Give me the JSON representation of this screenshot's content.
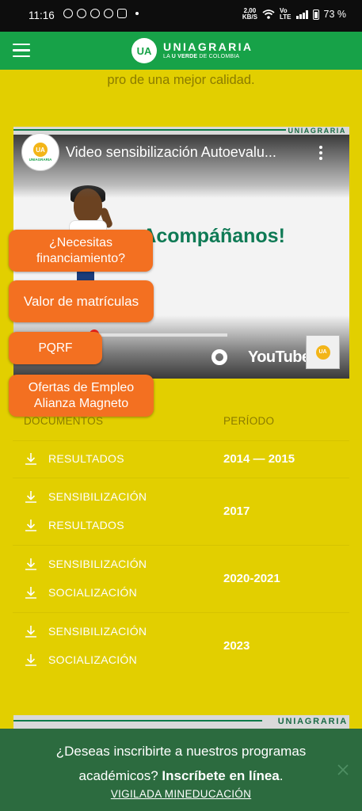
{
  "status_bar": {
    "time": "11:16",
    "speed_value": "2,00",
    "speed_unit": "KB/S",
    "network_label_1": "Vo",
    "network_label_2": "LTE",
    "battery": "73 %"
  },
  "header": {
    "logo_mark": "UA",
    "logo_name": "UNIAGRARIA",
    "logo_tagline_prefix": "LA ",
    "logo_tagline_bold": "U VERDE",
    "logo_tagline_suffix": " DE COLOMBIA",
    "menu_icon": "hamburger-icon"
  },
  "intro_text": "pro de una mejor calidad.",
  "video": {
    "brand_strip": "UNIAGRARIA",
    "channel_mark": "UA",
    "channel_name": "UNIAGRARIA",
    "title": "Video sensibilización Autoevalu...",
    "headline": "¡Acompáñanos!",
    "youtube_label": "YouTube",
    "progress_percent": 2,
    "thumb_mark": "UA"
  },
  "floating_buttons": [
    {
      "label": "¿Necesitas financiamiento?"
    },
    {
      "label": "Valor de matrículas"
    },
    {
      "label": "PQRF"
    },
    {
      "label": "Ofertas de Empleo Alianza Magneto"
    }
  ],
  "documents": {
    "col_documents": "DOCUMENTOS",
    "col_period": "PERÍODO",
    "rows": [
      {
        "links": [
          "RESULTADOS"
        ],
        "period": "2014 — 2015"
      },
      {
        "links": [
          "SENSIBILIZACIÓN",
          "RESULTADOS"
        ],
        "period": "2017"
      },
      {
        "links": [
          "SENSIBILIZACIÓN",
          "SOCIALIZACIÓN"
        ],
        "period": "2020-2021"
      },
      {
        "links": [
          "SENSIBILIZACIÓN",
          "SOCIALIZACIÓN"
        ],
        "period": "2023"
      }
    ]
  },
  "next_video_brand": "UNIAGRARIA",
  "banner": {
    "line1": "¿Deseas inscribirte a nuestros programas",
    "line2_prefix": "académicos? ",
    "line2_link": "Inscríbete en línea",
    "line2_suffix": ".",
    "footer_link": "VIGILADA MINEDUCACIÓN"
  },
  "colors": {
    "page_background": "#e2cf00",
    "header_green": "#17a248",
    "accent_orange": "#f37021",
    "banner_green": "#2c6b3f"
  }
}
